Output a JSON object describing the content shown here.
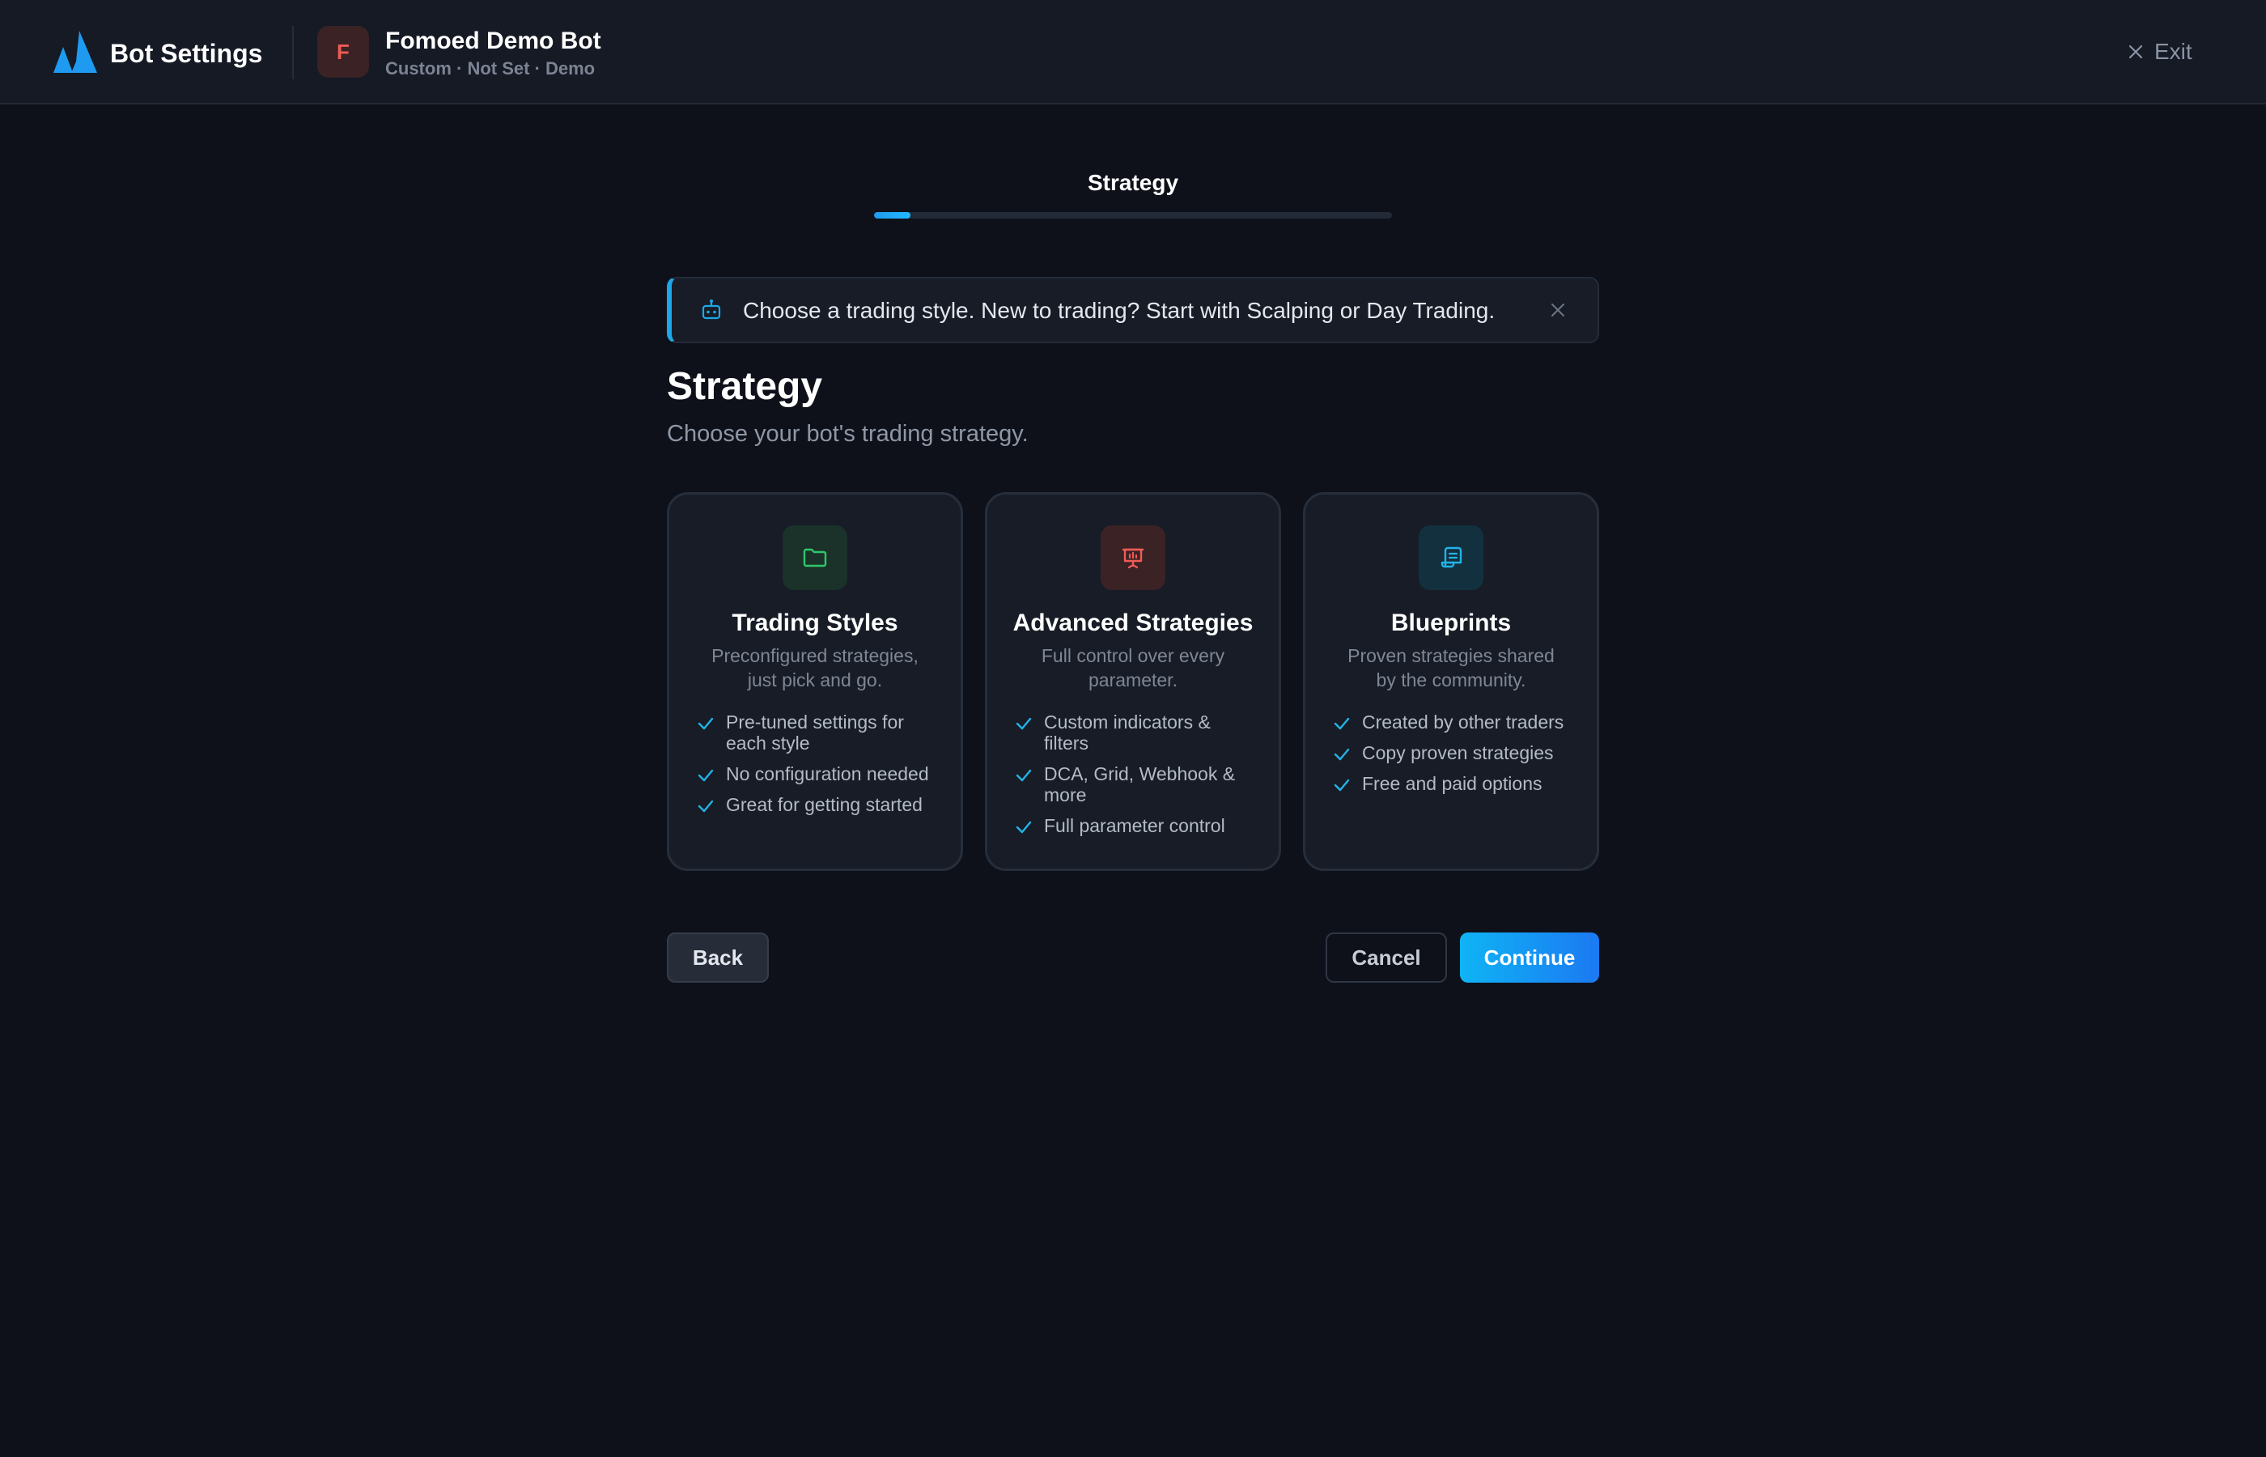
{
  "header": {
    "app_title": "Bot Settings",
    "bot_avatar_letter": "F",
    "bot_name": "Fomoed Demo Bot",
    "bot_meta": "Custom · Not Set · Demo",
    "exit_label": "Exit"
  },
  "stepper": {
    "current_step": "Strategy",
    "progress_percent": 7
  },
  "tip": {
    "text": "Choose a trading style. New to trading? Start with Scalping or Day Trading."
  },
  "page": {
    "title": "Strategy",
    "subtitle": "Choose your bot's trading strategy."
  },
  "cards": [
    {
      "title": "Trading Styles",
      "description": "Preconfigured strategies, just pick and go.",
      "icon": "folder-icon",
      "accent": "#2fc76b",
      "icon_bg": "#1a3229",
      "features": [
        "Pre-tuned settings for each style",
        "No configuration needed",
        "Great for getting started"
      ]
    },
    {
      "title": "Advanced Strategies",
      "description": "Full control over every parameter.",
      "icon": "presentation-chart-icon",
      "accent": "#ef5b55",
      "icon_bg": "#3a2225",
      "features": [
        "Custom indicators & filters",
        "DCA, Grid, Webhook & more",
        "Full parameter control"
      ]
    },
    {
      "title": "Blueprints",
      "description": "Proven strategies shared by the community.",
      "icon": "scroll-icon",
      "accent": "#22b3e6",
      "icon_bg": "#13303e",
      "features": [
        "Created by other traders",
        "Copy proven strategies",
        "Free and paid options"
      ]
    }
  ],
  "colors": {
    "accent": "#1ea7e8",
    "check": "#22b3e6",
    "background": "#0e111a",
    "surface": "#171c26"
  },
  "buttons": {
    "back": "Back",
    "cancel": "Cancel",
    "continue": "Continue"
  }
}
